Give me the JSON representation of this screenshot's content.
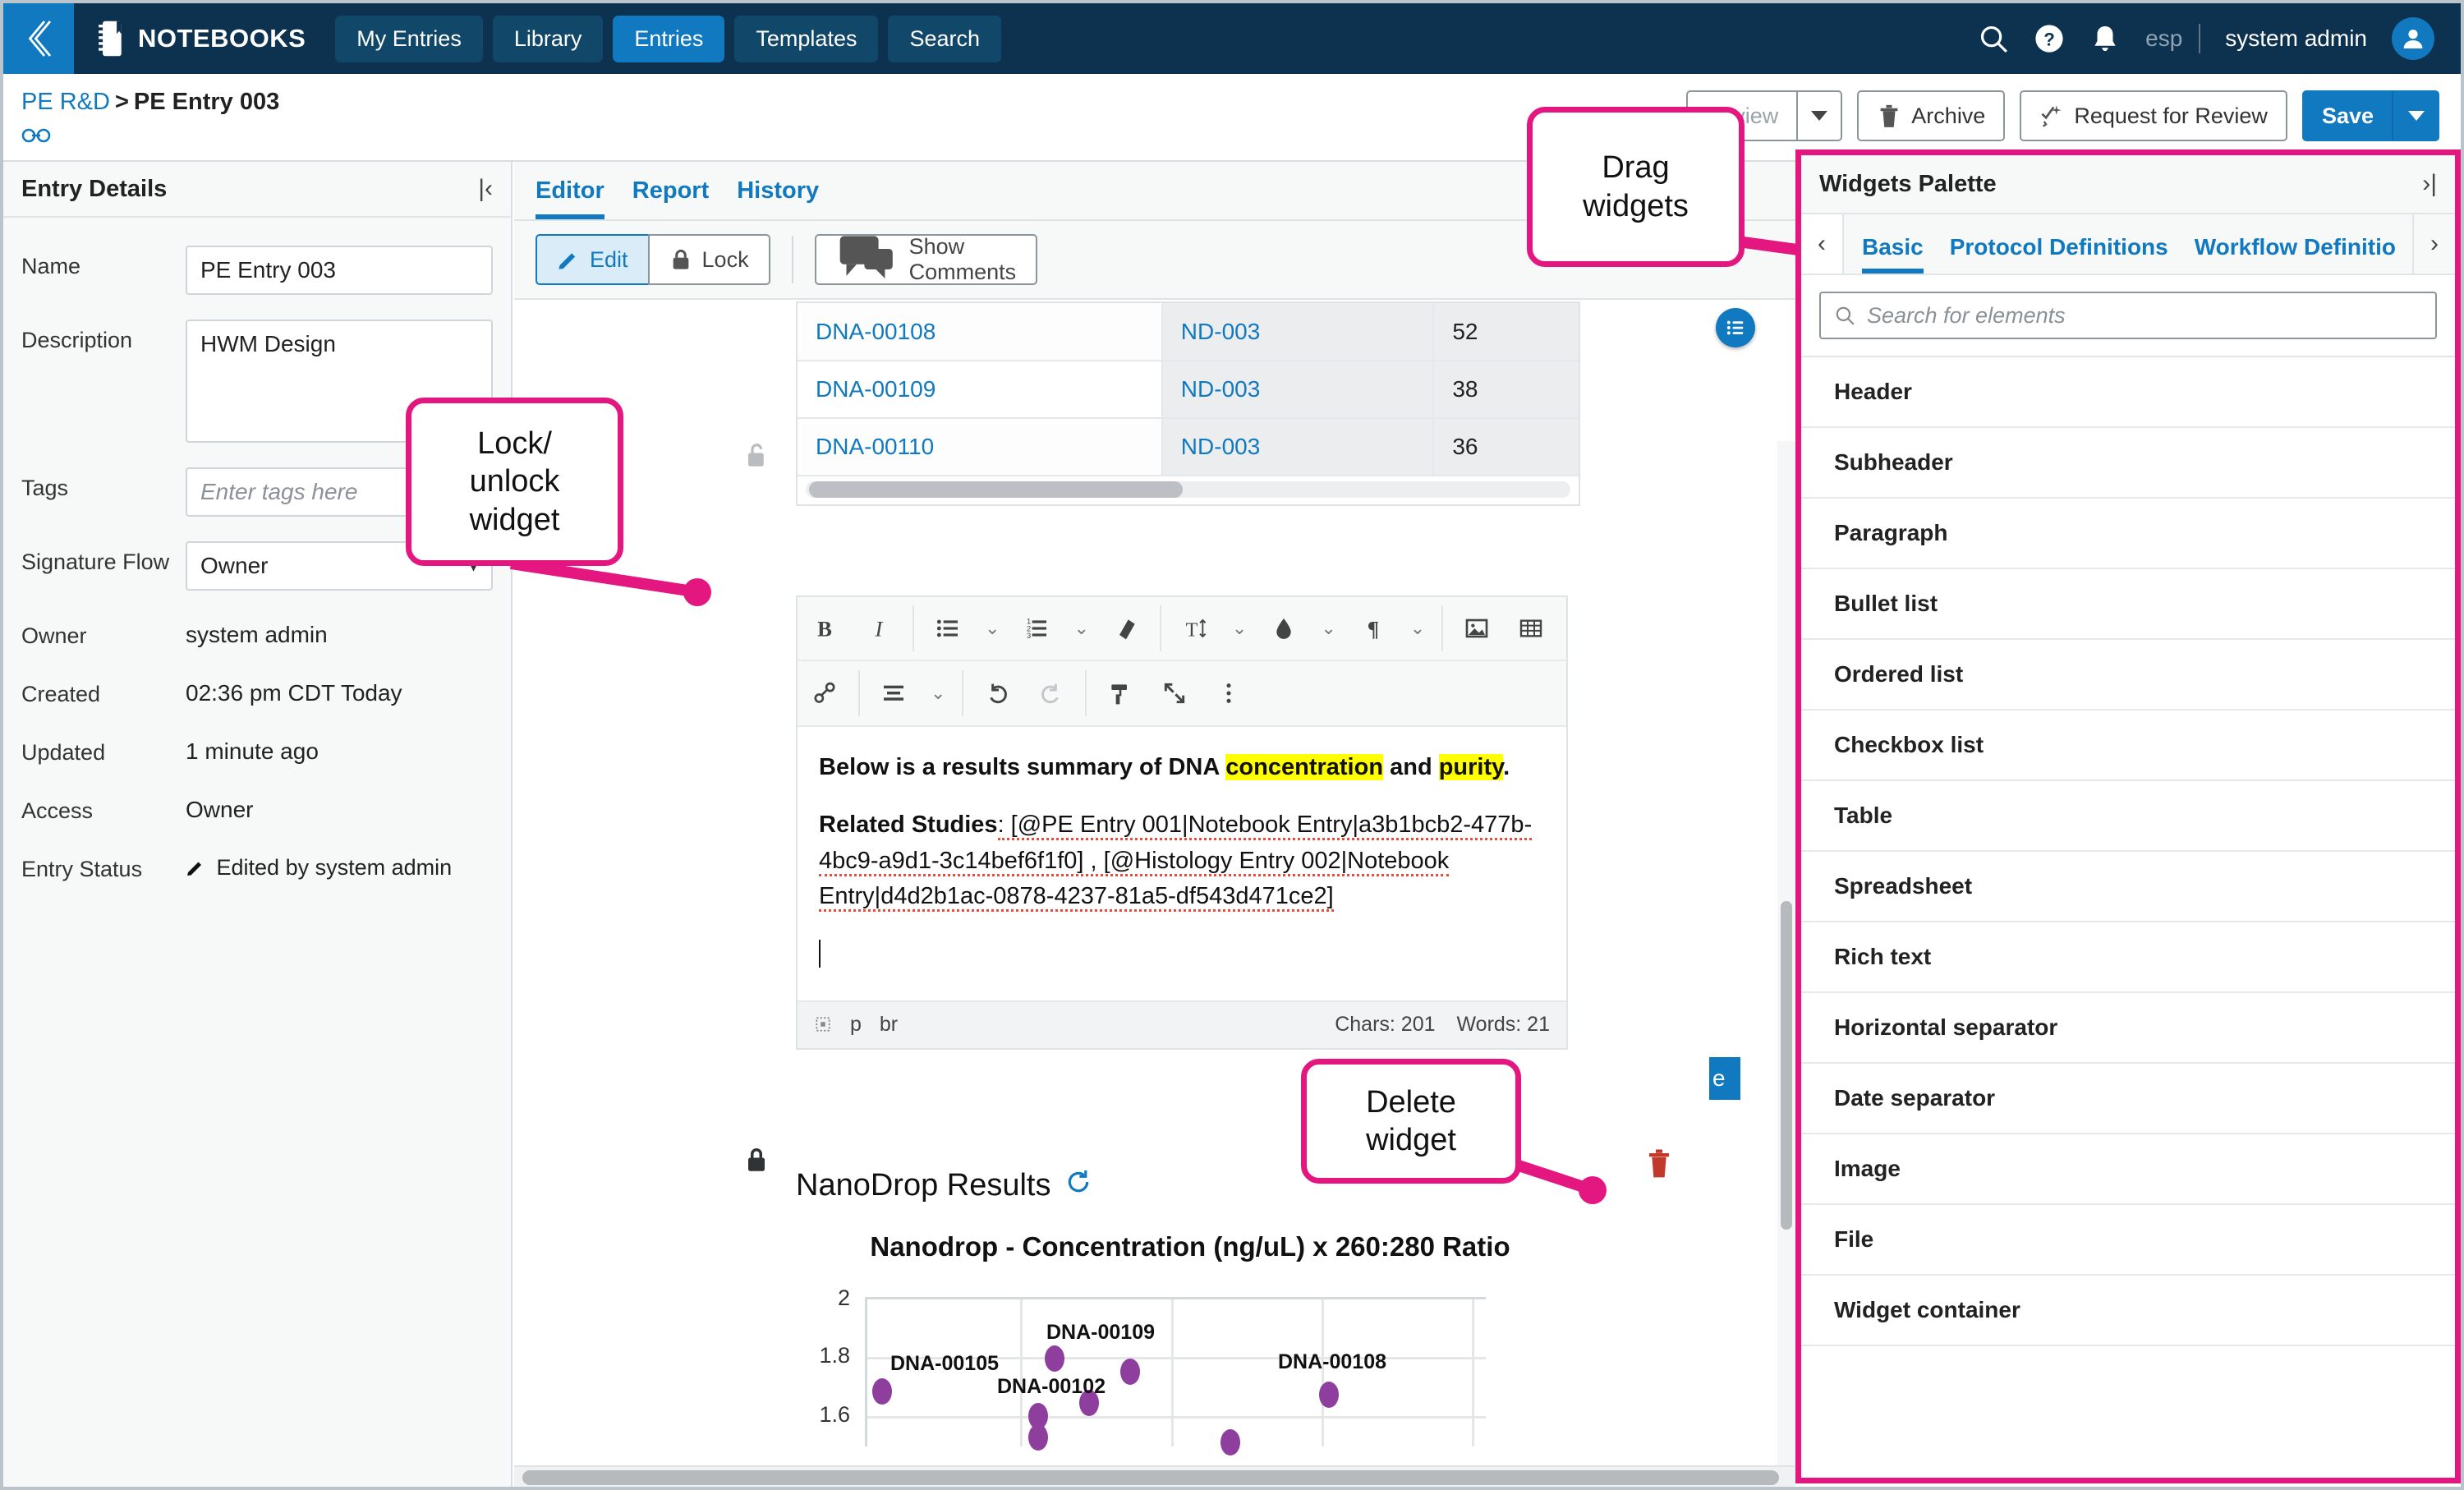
{
  "topnav": {
    "back_icon": "chevrons-left-icon",
    "brand": "NOTEBOOKS",
    "tabs": [
      {
        "label": "My Entries",
        "active": false
      },
      {
        "label": "Library",
        "active": false
      },
      {
        "label": "Entries",
        "active": true
      },
      {
        "label": "Templates",
        "active": false
      },
      {
        "label": "Search",
        "active": false
      }
    ],
    "search_icon": "search-icon",
    "help_icon": "help-circle-icon",
    "bell_icon": "bell-icon",
    "lang": "esp",
    "username": "system admin",
    "avatar_icon": "user-avatar-icon"
  },
  "breadcrumb": {
    "parent": "PE R&D",
    "separator": ">",
    "current": "PE Entry 003",
    "link_icon": "link-icon"
  },
  "actions": {
    "review_label": "Review",
    "review_caret": "chevron-down-icon",
    "archive_label": "Archive",
    "archive_icon": "trash-icon",
    "request_label": "Request for Review",
    "request_icon": "wand-icon",
    "save_label": "Save",
    "save_caret": "chevron-down-icon"
  },
  "entry_details": {
    "title": "Entry Details",
    "collapse_icon": "collapse-left-icon",
    "fields": [
      {
        "label": "Name",
        "value": "PE Entry 003",
        "kind": "input"
      },
      {
        "label": "Description",
        "value": "HWM Design",
        "kind": "textarea"
      },
      {
        "label": "Tags",
        "value": "",
        "placeholder": "Enter tags here",
        "kind": "input"
      },
      {
        "label": "Signature Flow",
        "value": "Owner",
        "kind": "select"
      },
      {
        "label": "Owner",
        "value": "system admin",
        "kind": "text"
      },
      {
        "label": "Created",
        "value": "02:36 pm CDT Today",
        "kind": "text"
      },
      {
        "label": "Updated",
        "value": "1 minute ago",
        "kind": "text"
      },
      {
        "label": "Access",
        "value": "Owner",
        "kind": "text"
      },
      {
        "label": "Entry Status",
        "value": "Edited by system admin",
        "kind": "text-icon",
        "icon": "pencil-icon"
      }
    ]
  },
  "editor": {
    "tabs": [
      {
        "label": "Editor",
        "active": true
      },
      {
        "label": "Report",
        "active": false
      },
      {
        "label": "History",
        "active": false
      }
    ],
    "edit_label": "Edit",
    "edit_icon": "pencil-icon",
    "lock_label": "Lock",
    "lock_icon": "lock-icon",
    "comments_label": "Show Comments",
    "comments_icon": "comment-icon"
  },
  "table_widget": {
    "rows": [
      {
        "sample": "DNA-00108",
        "instrument": "ND-003",
        "value": "52"
      },
      {
        "sample": "DNA-00109",
        "instrument": "ND-003",
        "value": "38"
      },
      {
        "sample": "DNA-00110",
        "instrument": "ND-003",
        "value": "36"
      }
    ],
    "drag_handle_icon": "list-handle-icon"
  },
  "rich_text": {
    "toolbar_row1": [
      {
        "icon": "bold-icon",
        "glyph": "B"
      },
      {
        "icon": "italic-icon",
        "glyph": "I"
      },
      {
        "icon": "bullet-list-icon"
      },
      {
        "icon": "chevron-down-icon"
      },
      {
        "icon": "numbered-list-icon"
      },
      {
        "icon": "chevron-down-icon"
      },
      {
        "icon": "eraser-icon"
      },
      {
        "icon": "font-size-icon"
      },
      {
        "icon": "chevron-down-icon"
      },
      {
        "icon": "text-color-icon"
      },
      {
        "icon": "chevron-down-icon"
      },
      {
        "icon": "paragraph-icon"
      },
      {
        "icon": "chevron-down-icon"
      },
      {
        "icon": "image-icon"
      },
      {
        "icon": "table-icon"
      }
    ],
    "toolbar_row2": [
      {
        "icon": "link-icon"
      },
      {
        "icon": "align-icon"
      },
      {
        "icon": "chevron-down-icon"
      },
      {
        "icon": "undo-icon"
      },
      {
        "icon": "redo-icon"
      },
      {
        "icon": "paint-roller-icon"
      },
      {
        "icon": "fullscreen-icon"
      },
      {
        "icon": "more-vertical-icon"
      }
    ],
    "paragraph1_prefix": "Below is a results summary of DNA ",
    "paragraph1_hl1": "concentration",
    "paragraph1_mid": " and ",
    "paragraph1_hl2": "purity",
    "paragraph1_suffix": ".",
    "paragraph2_label": "Related Studies",
    "paragraph2_text": ": [@PE Entry 001|Notebook Entry|a3b1bcb2-477b-4bc9-a9d1-3c14bef6f1f0] , [@Histology Entry 002|Notebook Entry|d4d2b1ac-0878-4237-81a5-df543d471ce2]",
    "status_tag1": "p",
    "status_tag2": "br",
    "chars": "Chars: 201",
    "words": "Words: 21",
    "status_icon": "element-path-icon"
  },
  "nanodrop": {
    "heading": "NanoDrop Results",
    "refresh_icon": "refresh-icon"
  },
  "chart_data": {
    "type": "scatter",
    "title": "Nanodrop - Concentration (ng/uL) x 260:280 Ratio",
    "xlabel": "",
    "ylabel": "",
    "ylim": [
      1.5,
      2
    ],
    "yticks": [
      2,
      1.8,
      1.6
    ],
    "grid": true,
    "legend": "none",
    "marker_color": "#8e3f9e",
    "annotations": [
      "DNA-00105",
      "DNA-00102",
      "DNA-00109",
      "DNA-00108"
    ],
    "points": [
      {
        "label": "DNA-00105",
        "x": 12,
        "y": 1.72
      },
      {
        "label": "DNA-00102",
        "x": 42,
        "y": 1.66
      },
      {
        "label": "DNA-00102",
        "x": 42,
        "y": 1.6
      },
      {
        "label": "DNA-00109",
        "x": 45,
        "y": 1.85
      },
      {
        "label": "DNA-00109",
        "x": 54,
        "y": 1.81
      },
      {
        "label": "",
        "x": 51,
        "y": 1.69
      },
      {
        "label": "",
        "x": 69,
        "y": 1.57
      },
      {
        "label": "DNA-00108",
        "x": 82,
        "y": 1.73
      }
    ]
  },
  "palette": {
    "title": "Widgets Palette",
    "expand_icon": "expand-right-icon",
    "prev_icon": "chevron-left-icon",
    "next_icon": "chevron-right-icon",
    "tabs": [
      {
        "label": "Basic",
        "active": true
      },
      {
        "label": "Protocol Definitions",
        "active": false
      },
      {
        "label": "Workflow Definitio",
        "active": false
      }
    ],
    "search_placeholder": "Search for elements",
    "search_icon": "search-icon",
    "items": [
      {
        "label": "Header"
      },
      {
        "label": "Subheader"
      },
      {
        "label": "Paragraph"
      },
      {
        "label": "Bullet list"
      },
      {
        "label": "Ordered list"
      },
      {
        "label": "Checkbox list"
      },
      {
        "label": "Table"
      },
      {
        "label": "Spreadsheet"
      },
      {
        "label": "Rich text"
      },
      {
        "label": "Horizontal separator"
      },
      {
        "label": "Date separator"
      },
      {
        "label": "Image"
      },
      {
        "label": "File"
      },
      {
        "label": "Widget container"
      }
    ]
  },
  "callouts": [
    {
      "id": "drag-widgets",
      "line1": "Drag",
      "line2": "widgets"
    },
    {
      "id": "lock-unlock-widget",
      "line1": "Lock/",
      "line2": "unlock",
      "line3": "widget"
    },
    {
      "id": "delete-widget",
      "line1": "Delete",
      "line2": "widget"
    }
  ],
  "colors": {
    "brand_dark": "#0c3250",
    "accent_blue": "#1079bf",
    "callout_pink": "#e3177f",
    "highlight_yellow": "#ffff00",
    "marker_purple": "#8e3f9e",
    "danger_red": "#c0392b"
  }
}
